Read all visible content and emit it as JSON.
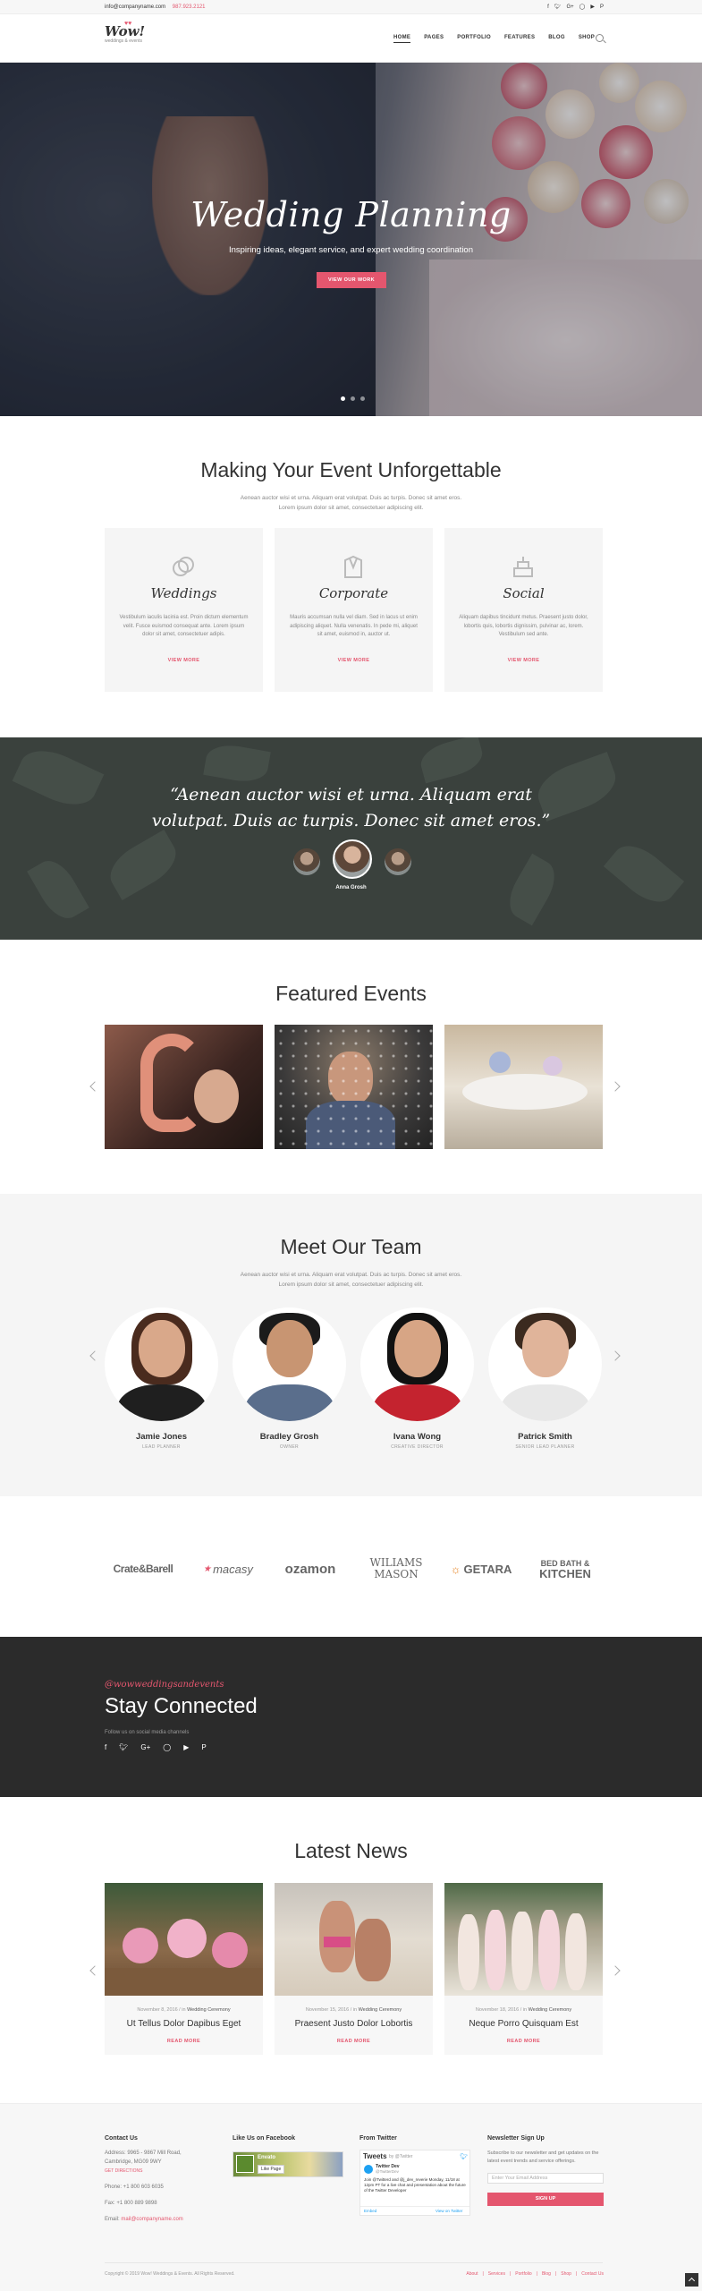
{
  "topbar": {
    "email": "info@companyname.com",
    "phone": "987.923.2121",
    "socials": [
      "facebook-icon",
      "twitter-icon",
      "google-plus-icon",
      "instagram-icon",
      "youtube-icon",
      "pinterest-icon"
    ]
  },
  "header": {
    "logo_text": "Wow!",
    "logo_sub": "weddings & events",
    "nav": [
      "HOME",
      "PAGES",
      "PORTFOLIO",
      "FEATURES",
      "BLOG",
      "SHOP"
    ]
  },
  "hero": {
    "title": "Wedding Planning",
    "subtitle": "Inspiring ideas, elegant service, and expert wedding coordination",
    "button": "VIEW OUR WORK",
    "slides": 3,
    "active_slide": 1
  },
  "services": {
    "title": "Making Your Event Unforgettable",
    "text_line1": "Aenean auctor wisi et urna. Aliquam erat volutpat. Duis ac turpis. Donec sit amet eros.",
    "text_line2": "Lorem ipsum dolor sit amet, consectetuer adipiscing elit.",
    "cards": [
      {
        "name": "Weddings",
        "icon": "rings-icon",
        "text": "Vestibulum iaculis lacinia est. Proin dictum elementum velit. Fusce euismod consequat ante. Lorem ipsum dolor sit amet, consectetuer adipis.",
        "more": "VIEW MORE"
      },
      {
        "name": "Corporate",
        "icon": "suit-icon",
        "text": "Mauris accumsan nulla vel diam. Sed in lacus ut enim adipiscing aliquet. Nulla venenatis. In pede mi, aliquet sit amet, euismod in, auctor ut.",
        "more": "VIEW MORE"
      },
      {
        "name": "Social",
        "icon": "cake-icon",
        "text": "Aliquam dapibus tincidunt metus. Praesent justo dolor, lobortis quis, lobortis dignissim, pulvinar ac, lorem. Vestibulum sed ante.",
        "more": "VIEW MORE"
      }
    ]
  },
  "testimonial": {
    "quote_line1": "“Aenean auctor wisi et urna. Aliquam erat",
    "quote_line2": "volutpat. Duis ac turpis. Donec sit amet eros.”",
    "name": "Anna Grosh"
  },
  "featured": {
    "title": "Featured Events",
    "items": [
      "balloon-photo",
      "groom-photo",
      "table-photo"
    ]
  },
  "team": {
    "title": "Meet Our Team",
    "text_line1": "Aenean auctor wisi et urna. Aliquam erat volutpat. Duis ac turpis. Donec sit amet eros.",
    "text_line2": "Lorem ipsum dolor sit amet, consectetuer adipiscing elit.",
    "members": [
      {
        "name": "Jamie Jones",
        "role": "LEAD PLANNER"
      },
      {
        "name": "Bradley Grosh",
        "role": "OWNER"
      },
      {
        "name": "Ivana Wong",
        "role": "CREATIVE DIRECTOR"
      },
      {
        "name": "Patrick Smith",
        "role": "SENIOR LEAD PLANNER"
      }
    ]
  },
  "clients": [
    "Crate&Barell",
    "macasy",
    "ozamon",
    "WILIAMS",
    "MASON",
    "GETARA",
    "BED BATH &",
    "KITCHEN"
  ],
  "stay": {
    "tag": "@wowweddingsandevents",
    "title": "Stay Connected",
    "subtitle": "Follow us on social media channels"
  },
  "news": {
    "title": "Latest News",
    "items": [
      {
        "date": "November 8, 2016",
        "sep": " / in ",
        "category": "Wedding Ceremony",
        "title": "Ut Tellus Dolor Dapibus Eget",
        "more": "READ MORE"
      },
      {
        "date": "November 15, 2016",
        "sep": " / in ",
        "category": "Wedding Ceremony",
        "title": "Praesent Justo Dolor Lobortis",
        "more": "READ MORE"
      },
      {
        "date": "November 18, 2016",
        "sep": " / in ",
        "category": "Wedding Ceremony",
        "title": "Neque Porro Quisquam Est",
        "more": "READ MORE"
      }
    ]
  },
  "footer": {
    "contact_h": "Contact Us",
    "address1": "Address: 9965 - 9867 Mill Road,",
    "address2": "Cambridge, MG09 9WY",
    "directions": "GET DIRECTIONS",
    "phone": "Phone: +1 800 603 6035",
    "fax": "Fax: +1 800 889 9898",
    "email_label": "Email: ",
    "email": "mail@companyname.com",
    "fb_h": "Like Us on Facebook",
    "fb_page": "Envato",
    "fb_like": "Like Page",
    "tw_h": "From Twitter",
    "tw_tweets": "Tweets",
    "tw_by": "by @Twitter",
    "tw_user": "Twitter Dev",
    "tw_handle": "@TwitterDev",
    "tw_text": "Join @Twitterd and @j_dev_reverie Monday, 11/18 at 12pm PT for a live chat and presentation about the future of the Twitter Developer",
    "tw_embed": "Embed",
    "tw_view": "View on Twitter",
    "nl_h": "Newsletter Sign Up",
    "nl_text": "Subscribe to our newsletter and get updates on the latest event trends and service offerings.",
    "nl_placeholder": "Enter Your Email Address",
    "nl_btn": "SIGN UP",
    "copyright": "Copyright © 2019 Wow! Weddings & Events. All Rights Reserved.",
    "links": [
      "About",
      "Services",
      "Portfolio",
      "Blog",
      "Shop",
      "Contact Us"
    ]
  },
  "colors": {
    "accent": "#e4566e",
    "dark": "#2b2b2b",
    "light": "#f5f5f5"
  }
}
